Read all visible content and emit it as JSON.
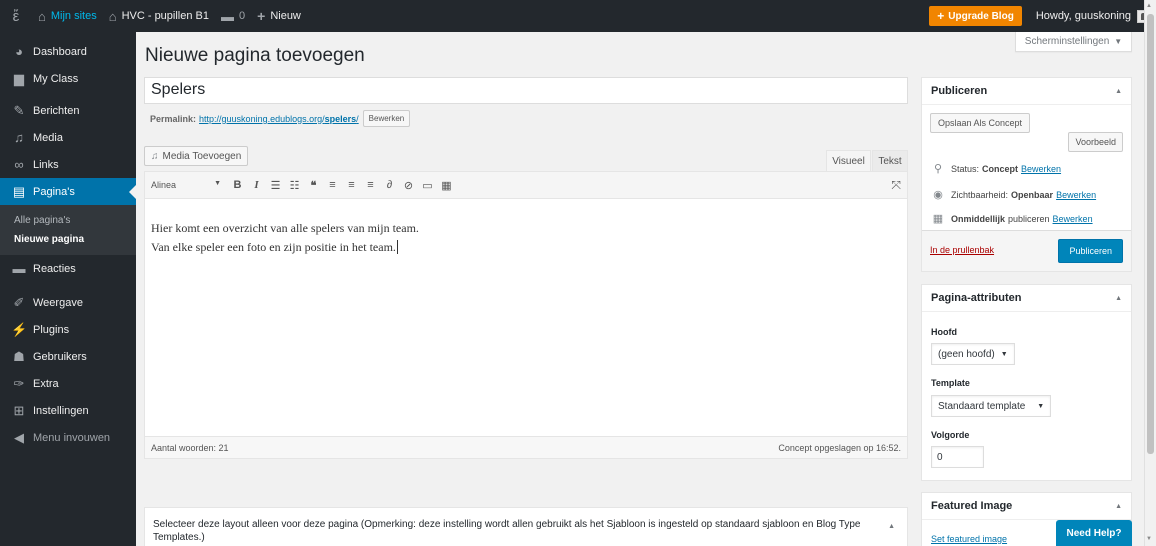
{
  "adminbar": {
    "my_sites": "Mijn sites",
    "site_name": "HVC - pupillen B1",
    "comments_count": "0",
    "new_label": "Nieuw",
    "upgrade_label": "Upgrade Blog",
    "howdy": "Howdy, guuskoning"
  },
  "sidebar": {
    "items": [
      {
        "label": "Dashboard",
        "icon": "dashboard-icon",
        "glyph": "◕"
      },
      {
        "label": "My Class",
        "icon": "class-icon",
        "glyph": "▆"
      },
      {
        "label": "Berichten",
        "icon": "pin-icon",
        "glyph": "✎"
      },
      {
        "label": "Media",
        "icon": "media-icon",
        "glyph": "♫"
      },
      {
        "label": "Links",
        "icon": "links-icon",
        "glyph": "∞"
      },
      {
        "label": "Pagina's",
        "icon": "pages-icon",
        "glyph": "▤"
      },
      {
        "label": "Reacties",
        "icon": "comments-icon",
        "glyph": "▬"
      },
      {
        "label": "Weergave",
        "icon": "appearance-icon",
        "glyph": "✐"
      },
      {
        "label": "Plugins",
        "icon": "plugins-icon",
        "glyph": "⚡"
      },
      {
        "label": "Gebruikers",
        "icon": "users-icon",
        "glyph": "☗"
      },
      {
        "label": "Extra",
        "icon": "tools-icon",
        "glyph": "✑"
      },
      {
        "label": "Instellingen",
        "icon": "settings-icon",
        "glyph": "⊞"
      },
      {
        "label": "Menu invouwen",
        "icon": "collapse-icon",
        "glyph": "◀"
      }
    ],
    "submenu": [
      "Alle pagina's",
      "Nieuwe pagina"
    ]
  },
  "screen_options": "Scherminstellingen",
  "page_title": "Nieuwe pagina toevoegen",
  "post_title": "Spelers",
  "permalink": {
    "label": "Permalink:",
    "url_base": "http://guuskoning.edublogs.org/",
    "slug": "spelers",
    "edit": "Bewerken"
  },
  "editor": {
    "media_button": "Media Toevoegen",
    "tab_visual": "Visueel",
    "tab_text": "Tekst",
    "format_select": "Alinea",
    "lines": [
      "Hier komt een overzicht van alle spelers van mijn team.",
      "Van elke speler een foto en zijn positie in het team."
    ],
    "word_count": "Aantal woorden: 21",
    "draft_saved": "Concept opgeslagen op 16:52."
  },
  "layout_box": {
    "text": "Selecteer deze layout alleen voor deze pagina (Opmerking: deze instelling wordt allen gebruikt als het Sjabloon is ingesteld op standaard sjabloon en Blog Type Templates.)"
  },
  "publish": {
    "title": "Publiceren",
    "save_draft": "Opslaan Als Concept",
    "preview": "Voorbeeld",
    "status_label": "Status:",
    "status_value": "Concept",
    "visibility_label": "Zichtbaarheid:",
    "visibility_value": "Openbaar",
    "schedule_value": "Onmiddellijk",
    "schedule_label": "publiceren",
    "edit": "Bewerken",
    "trash": "In de prullenbak",
    "publish_button": "Publiceren"
  },
  "page_attributes": {
    "title": "Pagina-attributen",
    "parent_label": "Hoofd",
    "parent_value": "(geen hoofd)",
    "template_label": "Template",
    "template_value": "Standaard template",
    "order_label": "Volgorde",
    "order_value": "0"
  },
  "featured_image": {
    "title": "Featured Image",
    "link": "Set featured image"
  },
  "need_help": "Need Help?",
  "colors": {
    "admin_dark": "#23282d",
    "accent": "#0073aa",
    "upgrade": "#f18500",
    "primary_button": "#0085ba",
    "trash": "#a00000"
  }
}
